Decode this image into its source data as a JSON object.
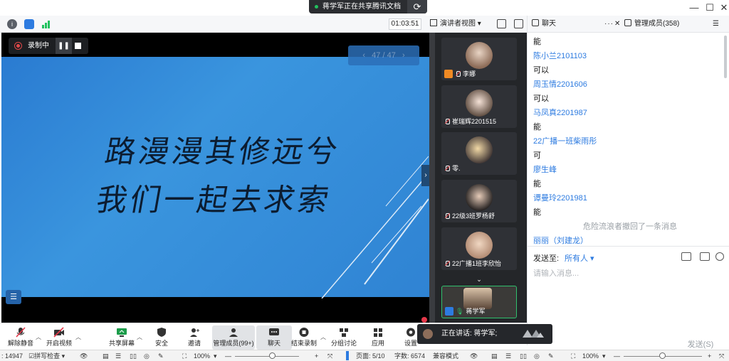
{
  "title_bar": {
    "share_banner": "蒋学军正在共享腾讯文档",
    "window_controls": [
      "minimize-icon",
      "maximize-icon",
      "close-icon"
    ]
  },
  "top_toolbar": {
    "timer": "01:03:51",
    "view_mode": "演讲者视图"
  },
  "stage": {
    "recording_label": "录制中",
    "page_indicator": "47 / 47",
    "slide_lines": [
      "路漫漫其修远兮",
      "我们一起去求索"
    ]
  },
  "participants": [
    {
      "name": "李娜",
      "host": true,
      "active": false
    },
    {
      "name": "崔瑞辉2201515",
      "host": false,
      "active": false
    },
    {
      "name": "零.",
      "host": false,
      "active": false
    },
    {
      "name": "22级3班罗杨舒",
      "host": false,
      "active": false
    },
    {
      "name": "22广播1班李欣怡",
      "host": false,
      "active": false
    },
    {
      "name": "蒋学军",
      "host": true,
      "active": true
    }
  ],
  "chat": {
    "tabs": [
      {
        "label": "聊天"
      },
      {
        "label": "管理成员(358)"
      }
    ],
    "messages": [
      {
        "type": "msg",
        "text": "能"
      },
      {
        "type": "sender",
        "text": "陈小兰2101103"
      },
      {
        "type": "msg",
        "text": "可以"
      },
      {
        "type": "sender",
        "text": "周玉情2201606"
      },
      {
        "type": "msg",
        "text": "可以"
      },
      {
        "type": "sender",
        "text": "马凤真2201987"
      },
      {
        "type": "msg",
        "text": "能"
      },
      {
        "type": "sender",
        "text": "22广播一班柴雨彤"
      },
      {
        "type": "msg",
        "text": "可"
      },
      {
        "type": "sender",
        "text": "廖生峰"
      },
      {
        "type": "msg",
        "text": "能"
      },
      {
        "type": "sender",
        "text": "谭曼玲2201981"
      },
      {
        "type": "msg",
        "text": "能"
      },
      {
        "type": "system",
        "text": "危险流浪者撤回了一条消息"
      },
      {
        "type": "sender",
        "text": "丽丽（刘建龙）"
      }
    ],
    "send_to_label": "发送至:",
    "send_to_target": "所有人",
    "input_placeholder": "请输入消息...",
    "send_button": "发送(S)"
  },
  "controls": [
    {
      "label": "解除静音",
      "icon": "microphone-muted-icon"
    },
    {
      "label": "开启视频",
      "icon": "camera-off-icon"
    },
    {
      "label": "共享屏幕",
      "icon": "share-screen-icon"
    },
    {
      "label": "安全",
      "icon": "shield-icon"
    },
    {
      "label": "邀请",
      "icon": "invite-user-icon"
    },
    {
      "label": "管理成员(99+)",
      "icon": "members-icon"
    },
    {
      "label": "聊天",
      "icon": "chat-icon"
    },
    {
      "label": "结束录制",
      "icon": "stop-record-icon"
    },
    {
      "label": "分组讨论",
      "icon": "breakout-icon"
    },
    {
      "label": "应用",
      "icon": "apps-icon"
    },
    {
      "label": "设置",
      "icon": "gear-icon"
    }
  ],
  "speaking_toast": "正在讲话: 蒋学军;",
  "status_bar": {
    "left_code": ": 14947",
    "spell_check": "拼写检查",
    "zoom_left": "100%",
    "page": "页面: 5/10",
    "word_count": "字数: 6574",
    "compat_mode": "兼容模式",
    "zoom_right": "100%"
  }
}
